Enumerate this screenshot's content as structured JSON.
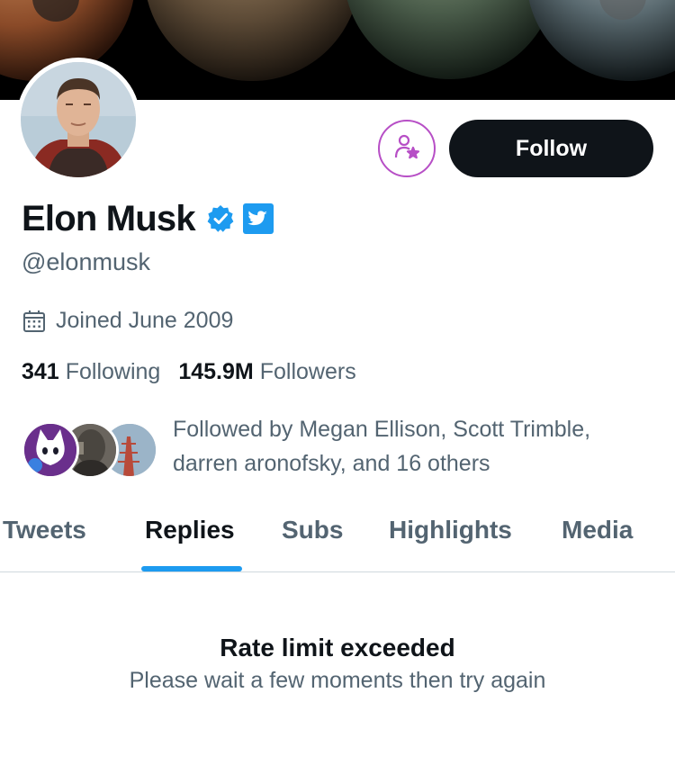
{
  "profile": {
    "name": "Elon Musk",
    "handle": "@elonmusk",
    "joined": "Joined June 2009",
    "following_count": "341",
    "following_label": "Following",
    "followers_count": "145.9M",
    "followers_label": "Followers",
    "followed_by": "Followed by Megan Ellison, Scott Trimble, darren aronofsky, and 16 others"
  },
  "actions": {
    "follow_label": "Follow",
    "subscribe_icon": "person-star-icon"
  },
  "badges": [
    "verified-badge-icon",
    "twitter-affiliate-icon"
  ],
  "tabs": [
    {
      "label": "Tweets",
      "active": false
    },
    {
      "label": "Replies",
      "active": true
    },
    {
      "label": "Subs",
      "active": false
    },
    {
      "label": "Highlights",
      "active": false
    },
    {
      "label": "Media",
      "active": false
    }
  ],
  "empty_state": {
    "title": "Rate limit exceeded",
    "body": "Please wait a few moments then try again"
  },
  "colors": {
    "accent": "#1d9bf0",
    "text_primary": "#0f1419",
    "text_secondary": "#536471",
    "subscribe_accent": "#b74fc6"
  }
}
